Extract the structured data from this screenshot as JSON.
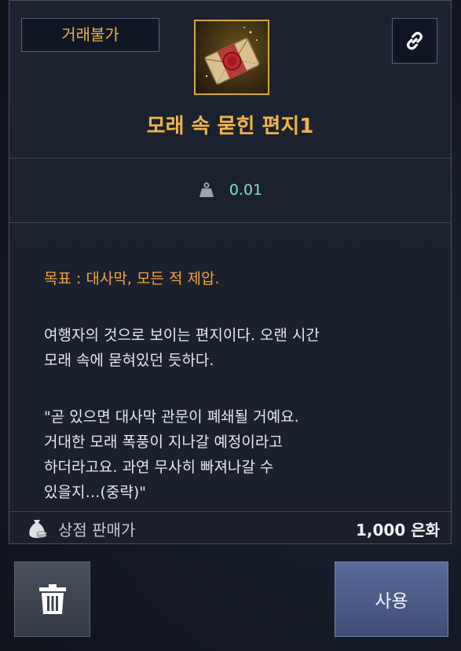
{
  "item": {
    "trade_badge": "거래불가",
    "title": "모래 속 묻힌 편지1",
    "weight": "0.01",
    "icon": "sealed-letter-icon",
    "goal": "목표 : 대사막, 모든 적 제압.",
    "description_lines": [
      "여행자의 것으로 보이는 편지이다. 오랜 시간",
      "모래 속에 묻혀있던 듯하다."
    ],
    "quote_lines": [
      "\"곧 있으면 대사막 관문이 폐쇄될 거예요.",
      "거대한 모래 폭풍이 지나갈 예정이라고",
      "하더라고요. 과연 무사히 빠져나갈 수",
      "있을지…(중략)\""
    ]
  },
  "shop": {
    "label": "상점 판매가",
    "price": "1,000 은화"
  },
  "actions": {
    "use_label": "사용"
  },
  "colors": {
    "title": "#f0b548",
    "goal": "#f0a53a",
    "weight": "#7fe0d4",
    "frame": "#d6a640"
  }
}
